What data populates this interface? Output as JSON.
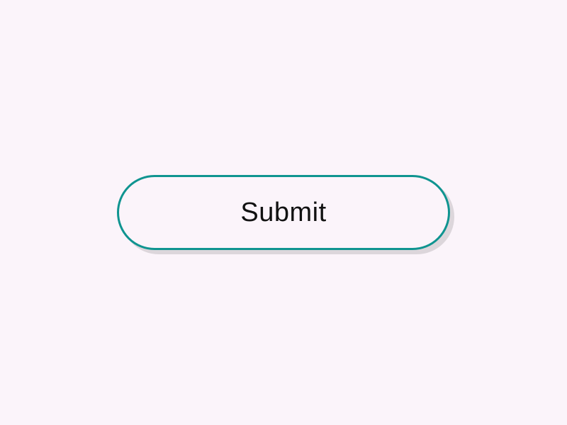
{
  "button": {
    "label": "Submit"
  }
}
